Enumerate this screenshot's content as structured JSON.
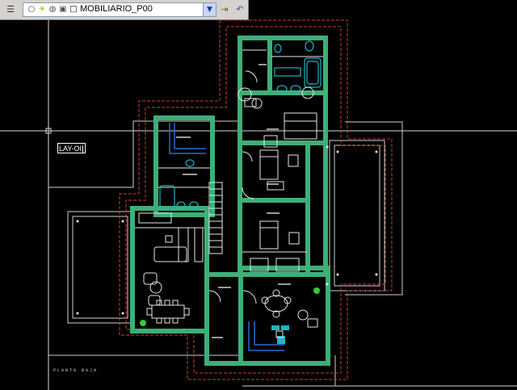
{
  "toolbar": {
    "layer_name": "MOBILIARIO_P00",
    "icons": [
      "layer-manager-icon",
      "lightbulb-icon",
      "sun-icon",
      "freeze-icon",
      "lock-icon",
      "color-swatch-icon",
      "dropdown-arrow-icon",
      "make-current-icon",
      "layer-previous-icon"
    ],
    "colors": {
      "bar": "#d6d3ce",
      "combo": "#ffffff",
      "swatch": "#ffffff"
    }
  },
  "command_input": {
    "value": "LAY-OI"
  },
  "plan": {
    "title": "PLANTA  BAJA",
    "colors": {
      "background": "#000000",
      "wall": "#3fae78",
      "outline_red": "#d23c3c",
      "lines_white": "#e6e6e6",
      "furniture": "#ffffff",
      "fixtures_cyan": "#1fb5c9",
      "blue": "#2a6bd6",
      "plant": "#3ac83a"
    }
  }
}
